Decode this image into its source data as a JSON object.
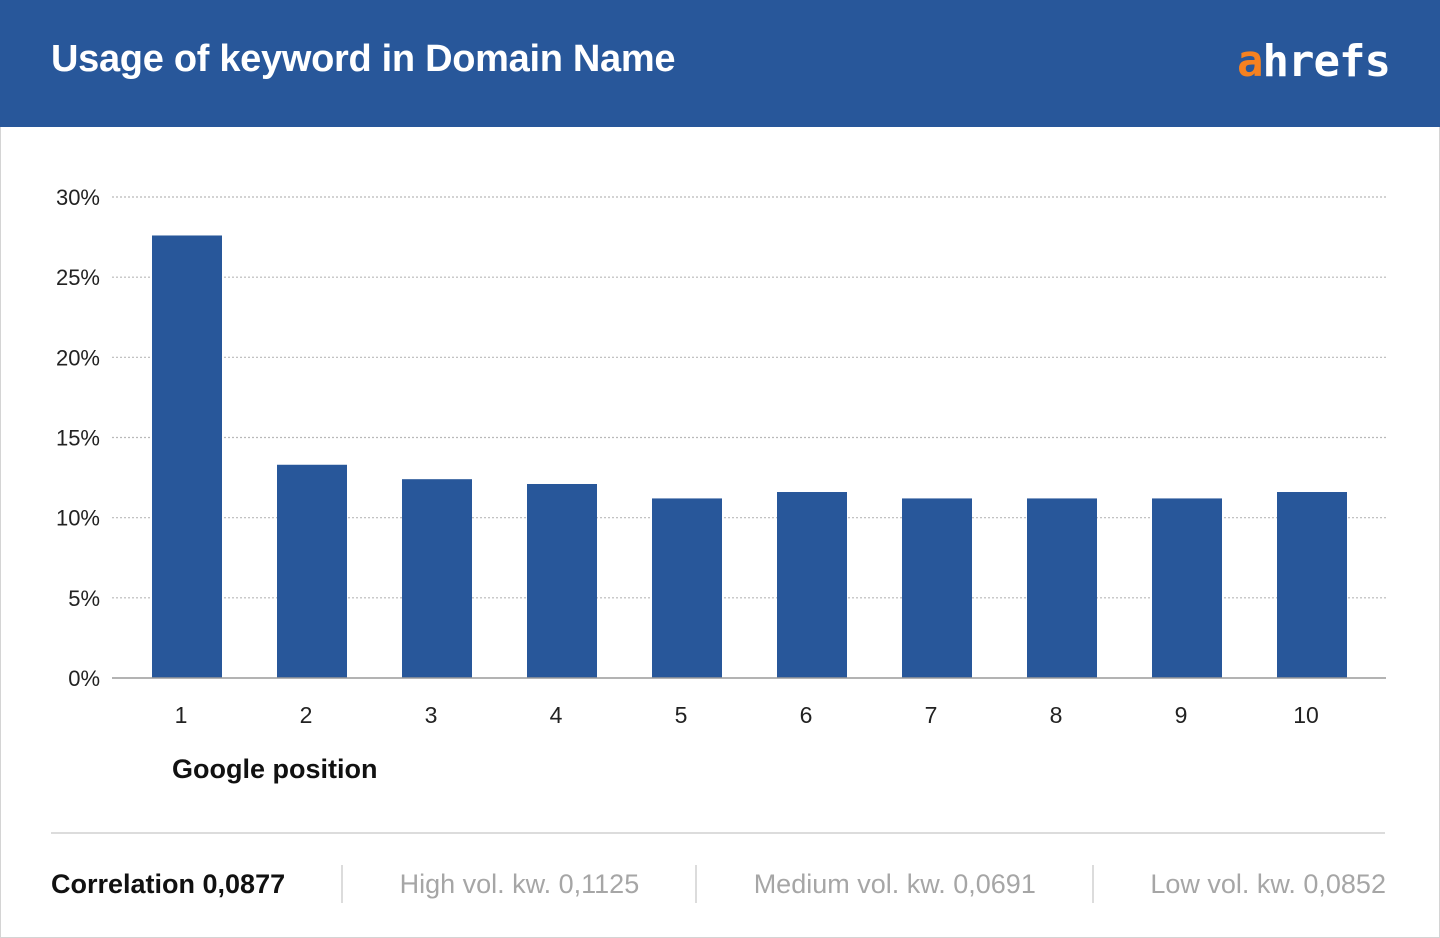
{
  "header": {
    "title": "Usage of keyword in Domain Name",
    "logo_prefix": "a",
    "logo_rest": "hrefs",
    "bg_color": "#28579a",
    "logo_accent_color": "#f58120"
  },
  "chart_data": {
    "type": "bar",
    "title": "Usage of keyword in Domain Name",
    "xlabel": "Google position",
    "ylabel": "",
    "categories": [
      "1",
      "2",
      "3",
      "4",
      "5",
      "6",
      "7",
      "8",
      "9",
      "10"
    ],
    "values": [
      27.6,
      13.3,
      12.4,
      12.1,
      11.2,
      11.6,
      11.2,
      11.2,
      11.2,
      11.6
    ],
    "ylim": [
      0,
      30
    ],
    "yticks": [
      0,
      5,
      10,
      15,
      20,
      25,
      30
    ],
    "ytick_labels": [
      "0%",
      "5%",
      "10%",
      "15%",
      "20%",
      "25%",
      "30%"
    ],
    "grid": true,
    "bar_color": "#28579a"
  },
  "footer": {
    "correlation": "Correlation 0,0877",
    "high": "High vol. kw. 0,1125",
    "medium": "Medium vol. kw. 0,0691",
    "low": "Low vol. kw. 0,0852"
  }
}
